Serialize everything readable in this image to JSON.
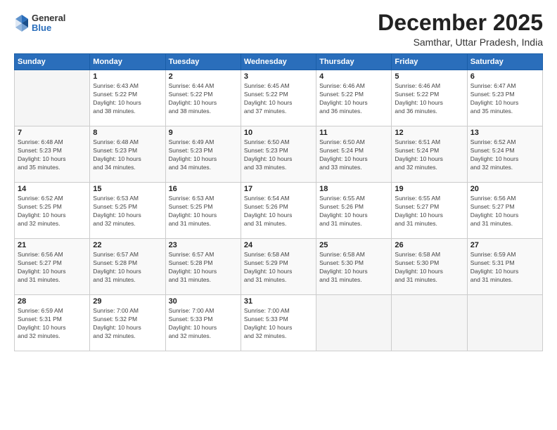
{
  "logo": {
    "general": "General",
    "blue": "Blue"
  },
  "header": {
    "month": "December 2025",
    "location": "Samthar, Uttar Pradesh, India"
  },
  "weekdays": [
    "Sunday",
    "Monday",
    "Tuesday",
    "Wednesday",
    "Thursday",
    "Friday",
    "Saturday"
  ],
  "weeks": [
    [
      {
        "day": "",
        "info": ""
      },
      {
        "day": "1",
        "info": "Sunrise: 6:43 AM\nSunset: 5:22 PM\nDaylight: 10 hours\nand 38 minutes."
      },
      {
        "day": "2",
        "info": "Sunrise: 6:44 AM\nSunset: 5:22 PM\nDaylight: 10 hours\nand 38 minutes."
      },
      {
        "day": "3",
        "info": "Sunrise: 6:45 AM\nSunset: 5:22 PM\nDaylight: 10 hours\nand 37 minutes."
      },
      {
        "day": "4",
        "info": "Sunrise: 6:46 AM\nSunset: 5:22 PM\nDaylight: 10 hours\nand 36 minutes."
      },
      {
        "day": "5",
        "info": "Sunrise: 6:46 AM\nSunset: 5:22 PM\nDaylight: 10 hours\nand 36 minutes."
      },
      {
        "day": "6",
        "info": "Sunrise: 6:47 AM\nSunset: 5:23 PM\nDaylight: 10 hours\nand 35 minutes."
      }
    ],
    [
      {
        "day": "7",
        "info": "Sunrise: 6:48 AM\nSunset: 5:23 PM\nDaylight: 10 hours\nand 35 minutes."
      },
      {
        "day": "8",
        "info": "Sunrise: 6:48 AM\nSunset: 5:23 PM\nDaylight: 10 hours\nand 34 minutes."
      },
      {
        "day": "9",
        "info": "Sunrise: 6:49 AM\nSunset: 5:23 PM\nDaylight: 10 hours\nand 34 minutes."
      },
      {
        "day": "10",
        "info": "Sunrise: 6:50 AM\nSunset: 5:23 PM\nDaylight: 10 hours\nand 33 minutes."
      },
      {
        "day": "11",
        "info": "Sunrise: 6:50 AM\nSunset: 5:24 PM\nDaylight: 10 hours\nand 33 minutes."
      },
      {
        "day": "12",
        "info": "Sunrise: 6:51 AM\nSunset: 5:24 PM\nDaylight: 10 hours\nand 32 minutes."
      },
      {
        "day": "13",
        "info": "Sunrise: 6:52 AM\nSunset: 5:24 PM\nDaylight: 10 hours\nand 32 minutes."
      }
    ],
    [
      {
        "day": "14",
        "info": "Sunrise: 6:52 AM\nSunset: 5:25 PM\nDaylight: 10 hours\nand 32 minutes."
      },
      {
        "day": "15",
        "info": "Sunrise: 6:53 AM\nSunset: 5:25 PM\nDaylight: 10 hours\nand 32 minutes."
      },
      {
        "day": "16",
        "info": "Sunrise: 6:53 AM\nSunset: 5:25 PM\nDaylight: 10 hours\nand 31 minutes."
      },
      {
        "day": "17",
        "info": "Sunrise: 6:54 AM\nSunset: 5:26 PM\nDaylight: 10 hours\nand 31 minutes."
      },
      {
        "day": "18",
        "info": "Sunrise: 6:55 AM\nSunset: 5:26 PM\nDaylight: 10 hours\nand 31 minutes."
      },
      {
        "day": "19",
        "info": "Sunrise: 6:55 AM\nSunset: 5:27 PM\nDaylight: 10 hours\nand 31 minutes."
      },
      {
        "day": "20",
        "info": "Sunrise: 6:56 AM\nSunset: 5:27 PM\nDaylight: 10 hours\nand 31 minutes."
      }
    ],
    [
      {
        "day": "21",
        "info": "Sunrise: 6:56 AM\nSunset: 5:27 PM\nDaylight: 10 hours\nand 31 minutes."
      },
      {
        "day": "22",
        "info": "Sunrise: 6:57 AM\nSunset: 5:28 PM\nDaylight: 10 hours\nand 31 minutes."
      },
      {
        "day": "23",
        "info": "Sunrise: 6:57 AM\nSunset: 5:28 PM\nDaylight: 10 hours\nand 31 minutes."
      },
      {
        "day": "24",
        "info": "Sunrise: 6:58 AM\nSunset: 5:29 PM\nDaylight: 10 hours\nand 31 minutes."
      },
      {
        "day": "25",
        "info": "Sunrise: 6:58 AM\nSunset: 5:30 PM\nDaylight: 10 hours\nand 31 minutes."
      },
      {
        "day": "26",
        "info": "Sunrise: 6:58 AM\nSunset: 5:30 PM\nDaylight: 10 hours\nand 31 minutes."
      },
      {
        "day": "27",
        "info": "Sunrise: 6:59 AM\nSunset: 5:31 PM\nDaylight: 10 hours\nand 31 minutes."
      }
    ],
    [
      {
        "day": "28",
        "info": "Sunrise: 6:59 AM\nSunset: 5:31 PM\nDaylight: 10 hours\nand 32 minutes."
      },
      {
        "day": "29",
        "info": "Sunrise: 7:00 AM\nSunset: 5:32 PM\nDaylight: 10 hours\nand 32 minutes."
      },
      {
        "day": "30",
        "info": "Sunrise: 7:00 AM\nSunset: 5:33 PM\nDaylight: 10 hours\nand 32 minutes."
      },
      {
        "day": "31",
        "info": "Sunrise: 7:00 AM\nSunset: 5:33 PM\nDaylight: 10 hours\nand 32 minutes."
      },
      {
        "day": "",
        "info": ""
      },
      {
        "day": "",
        "info": ""
      },
      {
        "day": "",
        "info": ""
      }
    ]
  ]
}
